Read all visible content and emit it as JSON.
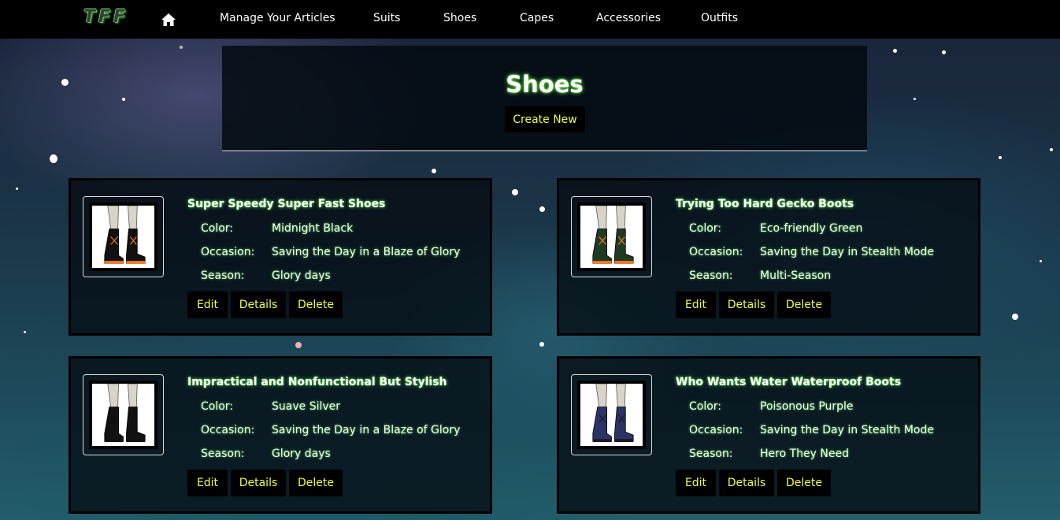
{
  "nav": {
    "brand": "TFF",
    "links": [
      "Manage Your Articles",
      "Suits",
      "Shoes",
      "Capes",
      "Accessories",
      "Outfits"
    ]
  },
  "header": {
    "title": "Shoes",
    "create_label": "Create New"
  },
  "labels": {
    "color": "Color:",
    "occasion": "Occasion:",
    "season": "Season:",
    "edit": "Edit",
    "details": "Details",
    "delete": "Delete"
  },
  "items": [
    {
      "name": "Super Speedy Super Fast Shoes",
      "color": "Midnight Black",
      "occasion": "Saving the Day in a Blaze of Glory",
      "season": "Glory days",
      "boot_color": "#111111",
      "accent_color": "#f07a2a"
    },
    {
      "name": "Trying Too Hard Gecko Boots",
      "color": "Eco-friendly Green",
      "occasion": "Saving the Day in Stealth Mode",
      "season": "Multi-Season",
      "boot_color": "#1f3a22",
      "accent_color": "#f07a2a"
    },
    {
      "name": "Impractical and Nonfunctional But Stylish",
      "color": "Suave Silver",
      "occasion": "Saving the Day in a Blaze of Glory",
      "season": "Glory days",
      "boot_color": "#111111",
      "accent_color": "#111111"
    },
    {
      "name": "Who Wants Water Waterproof Boots",
      "color": "Poisonous Purple",
      "occasion": "Saving the Day in Stealth Mode",
      "season": "Hero They Need",
      "boot_color": "#2a3566",
      "accent_color": "#1a1a2a"
    }
  ],
  "colors": {
    "navbar_bg": "#000000",
    "button_text": "#f0ff3a",
    "glow": "#5fe84a"
  }
}
